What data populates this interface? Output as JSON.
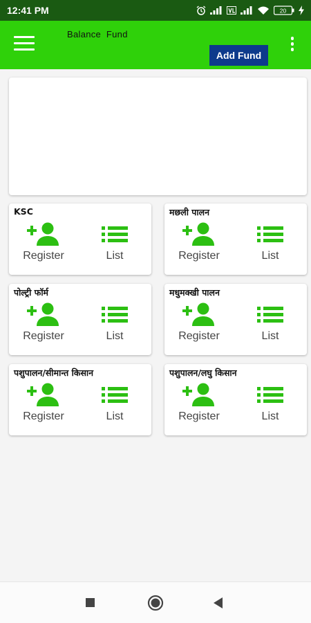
{
  "status_bar": {
    "time": "12:41 PM",
    "battery_level": "20"
  },
  "app_bar": {
    "balance_label": "Balance  Fund",
    "add_fund_label": "Add Fund",
    "colors": {
      "app_bar_bg": "#2fd10a",
      "add_fund_bg": "#0d3a8c"
    }
  },
  "cards": [
    {
      "title": "KSC",
      "register_label": "Register",
      "list_label": "List"
    },
    {
      "title": "मछली पालन",
      "register_label": "Register",
      "list_label": "List"
    },
    {
      "title": "पोल्ट्री फॉर्म",
      "register_label": "Register",
      "list_label": "List"
    },
    {
      "title": "मधुमक्खी पालन",
      "register_label": "Register",
      "list_label": "List"
    },
    {
      "title": "पशुपालन/सीमान्त किसान",
      "register_label": "Register",
      "list_label": "List"
    },
    {
      "title": "पशुपालन/लघु किसान",
      "register_label": "Register",
      "list_label": "List"
    }
  ],
  "icons": {
    "register": "add-person-icon",
    "list": "list-icon",
    "accent_color": "#2cbf12"
  }
}
